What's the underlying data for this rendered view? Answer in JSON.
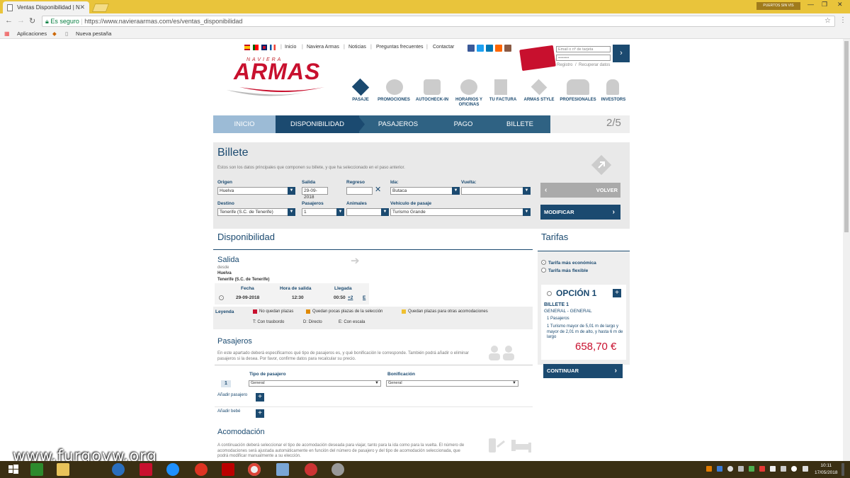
{
  "browser": {
    "tab_title": "Ventas Disponibilidad | N",
    "user_button": "PUERTOS SIN VIS",
    "security_label": "Es seguro",
    "url": "https://www.navieraarmas.com/es/ventas_disponibilidad",
    "bookmarks": [
      "Aplicaciones",
      "Nueva pestaña"
    ]
  },
  "header": {
    "top_links": [
      "Inicio",
      "Naviera Armas",
      "Noticias",
      "Preguntas frecuentes",
      "Contactar"
    ],
    "logo_naviera": "Naviera",
    "logo_armas": "ARMAS",
    "login_placeholder": "Email o nº de tarjeta",
    "password_value": "••••••••",
    "register_text": "Registro",
    "recover_text": "Recuperar datos",
    "nav_items": [
      "PASAJE",
      "PROMOCIONES",
      "AUTOCHECK-IN",
      "HORARIOS Y OFICINAS",
      "TU FACTURA",
      "ARMAS STYLE",
      "PROFESIONALES",
      "INVESTORS"
    ]
  },
  "steps": {
    "items": [
      "INICIO",
      "DISPONIBILIDAD",
      "PASAJEROS",
      "PAGO",
      "BILLETE"
    ],
    "counter": "2/5"
  },
  "billete": {
    "title": "Billete",
    "description": "Estos son los datos principales que componen su billete, y que ha seleccionado en el paso anterior.",
    "origen_label": "Origen",
    "origen_value": "Huelva",
    "salida_label": "Salida",
    "salida_value": "29-09-2018",
    "regreso_label": "Regreso",
    "ida_label": "Ida:",
    "ida_value": "Butaca",
    "vuelta_label": "Vuelta:",
    "destino_label": "Destino",
    "destino_value": "Tenerife (S.C. de Tenerife)",
    "pasajeros_label": "Pasajeros",
    "pasajeros_value": "1",
    "animales_label": "Animales",
    "vehiculo_label": "Vehículo de pasaje",
    "vehiculo_value": "Turismo Grande",
    "volver": "VOLVER",
    "modificar": "MODIFICAR"
  },
  "disponibilidad": {
    "title": "Disponibilidad",
    "salida_title": "Salida",
    "desde": "desde",
    "origen": "Huelva",
    "destino": "Tenerife (S.C. de Tenerife)",
    "col_fecha": "Fecha",
    "col_hora": "Hora de salida",
    "col_llegada": "Llegada",
    "fecha": "29-09-2018",
    "hora": "12:30",
    "llegada": "00:50",
    "plus": "+2",
    "e": "E",
    "leyenda": "Leyenda",
    "legend_items": [
      "No quedan plazas",
      "Quedan pocas plazas de la selección",
      "Quedan plazas para otras acomodaciones"
    ],
    "legend_colors": [
      "#c8102e",
      "#e08a00",
      "#f0c030"
    ],
    "legend_codes": [
      "T: Con trasbordo",
      "D: Directo",
      "E: Con escala"
    ]
  },
  "pasajeros": {
    "title": "Pasajeros",
    "description": "En este apartado deberá especificarnos qué tipo de pasajeros es, y qué bonificación le corresponde. También podrá añadir o eliminar pasajeros si la desea. Por favor, confirme datos para recalcular su precio.",
    "col_tipo": "Tipo de pasajero",
    "col_bonificacion": "Bonificación",
    "row_number": "1",
    "tipo_value": "General",
    "bonificacion_value": "General",
    "add_pasajero": "Añadir pasajero",
    "add_bebe": "Añadir bebé"
  },
  "acomodacion": {
    "title": "Acomodación",
    "description": "A continuación deberá seleccionar el tipo de acomodación deseada para viajar, tanto para la ida como para la vuelta. El número de acomodaciones será ajustada automáticamente en función del número de pasajero y del tipo de acomodación seleccionada, que podrá modificar manualmente a su elección."
  },
  "tarifas": {
    "title": "Tarifas",
    "option_economica": "Tarifa más económica",
    "option_flexible": "Tarifa más flexible",
    "opcion_title": "OPCIÓN 1",
    "billete_label": "BILLETE 1",
    "billete_sub": "GENERAL - GENERAL",
    "pasajeros": "1 Pasajeros",
    "vehiculo": "1 Turismo mayor de 5,01 m de largo y mayor de 2,01 m de alto, y hasta 6 m de largo",
    "price": "658,70 €",
    "continuar": "CONTINUAR"
  },
  "watermark": "www.furgovw.org",
  "taskbar": {
    "time": "10:11",
    "date": "17/05/2018"
  },
  "colors": {
    "brand_blue": "#1b4a70",
    "brand_red": "#c8102e",
    "step_active": "#1b4a70",
    "step_inactive": "#2f6283"
  }
}
